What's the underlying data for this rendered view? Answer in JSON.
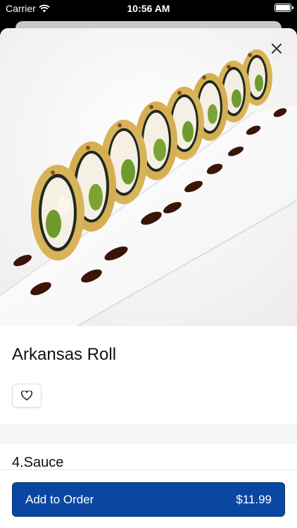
{
  "status_bar": {
    "carrier": "Carrier",
    "time": "10:56 AM"
  },
  "item": {
    "title": "Arkansas Roll"
  },
  "section": {
    "title": "4.Sauce"
  },
  "order_button": {
    "label": "Add to Order",
    "price": "$11.99"
  },
  "colors": {
    "accent": "#0a47a3",
    "sauce": "#3b1408",
    "avocado": "#6f9a2c",
    "tempura": "#d9b35a"
  },
  "icons": [
    "wifi-icon",
    "battery-icon",
    "close-icon",
    "heart-icon"
  ]
}
